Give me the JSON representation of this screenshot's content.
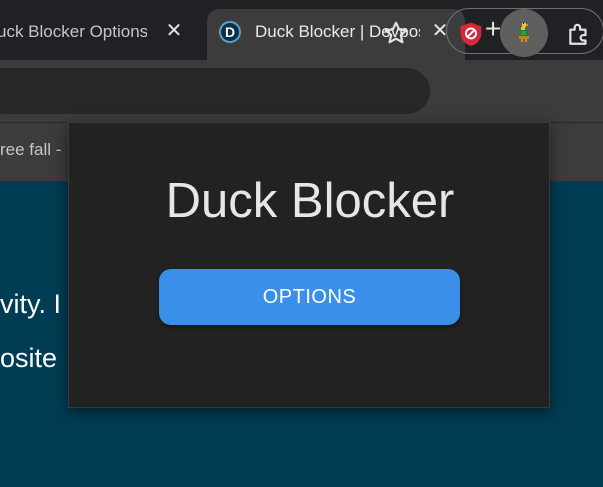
{
  "tabs": {
    "inactive": {
      "title": "uck Blocker Options",
      "close_glyph": "✕"
    },
    "active": {
      "favicon_letter": "D",
      "title": "Duck Blocker | Devpost",
      "close_glyph": "✕"
    },
    "new_tab_glyph": "+"
  },
  "toolbar": {
    "bookmark_star": "star-icon",
    "extensions": [
      "ublock-shield-icon",
      "duck-icon",
      "puzzle-icon"
    ]
  },
  "bookmarks_bar": {
    "visible_text": "ree fall - "
  },
  "page": {
    "line1": "vity. I",
    "line2": "osite"
  },
  "popup": {
    "title": "Duck Blocker",
    "options_label": "OPTIONS",
    "button_color": "#3a90e8",
    "background_color": "#222222"
  },
  "colors": {
    "page_background": "#003c53",
    "browser_chrome": "#3c3c3c",
    "tab_strip": "#202124"
  }
}
